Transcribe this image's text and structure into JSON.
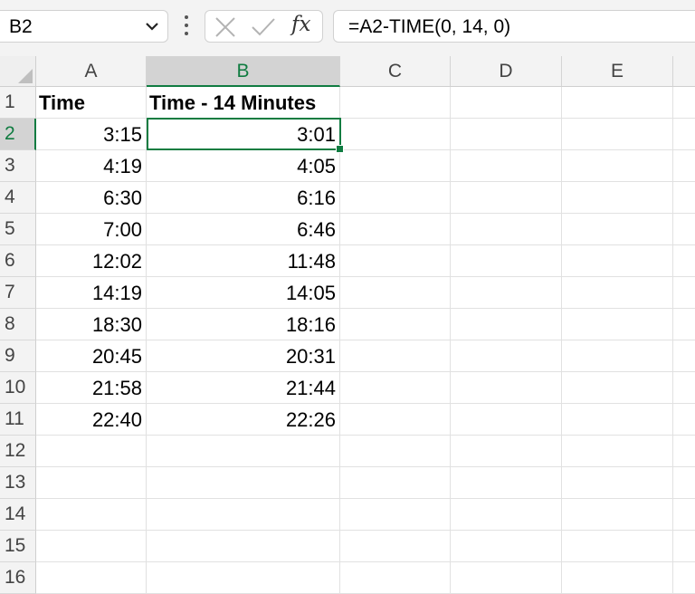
{
  "name_box": {
    "value": "B2"
  },
  "formula_bar": {
    "formula": "=A2-TIME(0, 14, 0)",
    "fx_label": "fx"
  },
  "columns": [
    "A",
    "B",
    "C",
    "D",
    "E"
  ],
  "selected_column": "B",
  "rows": [
    "1",
    "2",
    "3",
    "4",
    "5",
    "6",
    "7",
    "8",
    "9",
    "10",
    "11",
    "12",
    "13",
    "14",
    "15",
    "16"
  ],
  "selected_row": "2",
  "header": {
    "a": "Time",
    "b": "Time - 14 Minutes"
  },
  "data": [
    {
      "a": "3:15",
      "b": "3:01"
    },
    {
      "a": "4:19",
      "b": "4:05"
    },
    {
      "a": "6:30",
      "b": "6:16"
    },
    {
      "a": "7:00",
      "b": "6:46"
    },
    {
      "a": "12:02",
      "b": "11:48"
    },
    {
      "a": "14:19",
      "b": "14:05"
    },
    {
      "a": "18:30",
      "b": "18:16"
    },
    {
      "a": "20:45",
      "b": "20:31"
    },
    {
      "a": "21:58",
      "b": "21:44"
    },
    {
      "a": "22:40",
      "b": "22:26"
    }
  ],
  "colors": {
    "selection": "#107c41",
    "header_bg": "#f3f3f3"
  }
}
